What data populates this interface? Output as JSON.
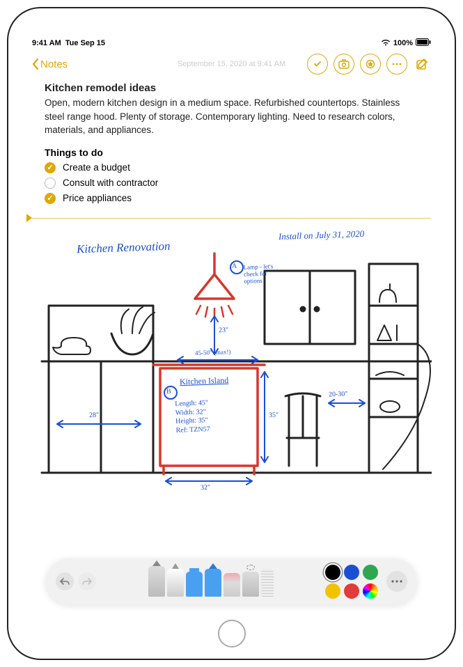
{
  "status": {
    "time": "9:41 AM",
    "date": "Tue Sep 15",
    "battery": "100%"
  },
  "nav": {
    "back_label": "Notes",
    "date_stamp": "September 15, 2020 at 9:41 AM"
  },
  "note": {
    "title": "Kitchen remodel ideas",
    "body": "Open, modern kitchen design in a medium space. Refurbished countertops. Stainless steel range hood. Plenty of storage. Contemporary lighting. Need to research colors, materials, and appliances.",
    "todo_header": "Things to do",
    "todos": [
      {
        "label": "Create a budget",
        "checked": true
      },
      {
        "label": "Consult with contractor",
        "checked": false
      },
      {
        "label": "Price appliances",
        "checked": true
      }
    ]
  },
  "sketch": {
    "title": "Kitchen Renovation",
    "install_note": "Install on July 31, 2020",
    "annotation_a": "Lamp - let's check for options",
    "circle_a": "A",
    "circle_b": "B",
    "island_header": "Kitchen Island",
    "island_specs": "Length: 45\"\nWidth: 32\"\nHeight: 35\"\nRef: TZN57",
    "dim_left": "28\"",
    "dim_lamp": "23\"",
    "dim_top": "45-50\" (max!)",
    "dim_island_h": "35\"",
    "dim_island_w": "32\"",
    "dim_right": "20-30\""
  },
  "toolbar": {
    "tools": [
      "pen",
      "marker",
      "highlighter",
      "pencil",
      "eraser",
      "lasso",
      "ruler"
    ],
    "colors": [
      "#000000",
      "#1a4fd4",
      "#2fa64f",
      "#f2c200",
      "#e23b3b"
    ],
    "selected_color": "#000000"
  }
}
